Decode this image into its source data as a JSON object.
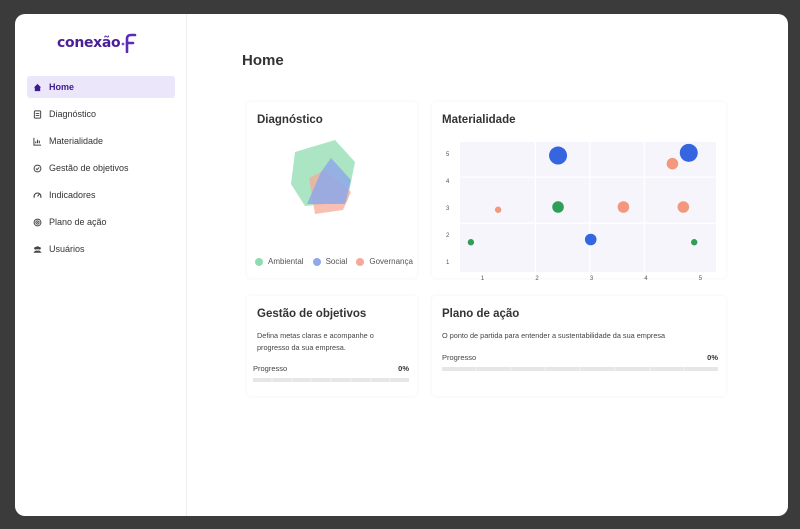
{
  "brand": {
    "name": "conexão",
    "mark": "F",
    "color": "#4b1f98"
  },
  "sidebar": {
    "items": [
      {
        "label": "Home",
        "icon": "home-icon",
        "active": true
      },
      {
        "label": "Diagnóstico",
        "icon": "clipboard-icon",
        "active": false
      },
      {
        "label": "Materialidade",
        "icon": "chart-icon",
        "active": false
      },
      {
        "label": "Gestão de objetivos",
        "icon": "target-icon",
        "active": false
      },
      {
        "label": "Indicadores",
        "icon": "gauge-icon",
        "active": false
      },
      {
        "label": "Plano de ação",
        "icon": "plan-icon",
        "active": false
      },
      {
        "label": "Usuários",
        "icon": "users-icon",
        "active": false
      }
    ]
  },
  "main": {
    "title": "Home",
    "diagnostico": {
      "title": "Diagnóstico",
      "legend": [
        {
          "label": "Ambiental",
          "color": "#8fdcb0"
        },
        {
          "label": "Social",
          "color": "#8fa8ea"
        },
        {
          "label": "Governança",
          "color": "#f5a99a"
        }
      ]
    },
    "materialidade": {
      "title": "Materialidade",
      "y_ticks": [
        "5",
        "4",
        "3",
        "2",
        "1"
      ],
      "x_ticks": [
        "1",
        "2",
        "3",
        "4",
        "5"
      ]
    },
    "gestao": {
      "title": "Gestão de objetivos",
      "description": "Defina metas claras e acompanhe o progresso da sua empresa.",
      "progress_label": "Progresso",
      "progress_value": "0%",
      "progress_fraction": 0
    },
    "plano": {
      "title": "Plano de ação",
      "description": "O ponto de partida para entender a sustentabilidade da sua empresa",
      "progress_label": "Progresso",
      "progress_value": "0%",
      "progress_fraction": 0
    }
  },
  "chart_data": [
    {
      "type": "radar",
      "title": "Diagnóstico",
      "series": [
        {
          "name": "Ambiental",
          "color": "#8fdcb0"
        },
        {
          "name": "Social",
          "color": "#8fa8ea"
        },
        {
          "name": "Governança",
          "color": "#f5a99a"
        }
      ]
    },
    {
      "type": "scatter",
      "title": "Materialidade",
      "xlim": [
        0.8,
        5.5
      ],
      "ylim": [
        0.7,
        5.5
      ],
      "y_ticks": [
        1,
        2,
        3,
        4,
        5
      ],
      "x_ticks": [
        1,
        2,
        3,
        4,
        5
      ],
      "points": [
        {
          "x": 2.6,
          "y": 5.0,
          "size": "large",
          "color": "#3566e0"
        },
        {
          "x": 5.0,
          "y": 5.1,
          "size": "large",
          "color": "#3566e0"
        },
        {
          "x": 4.7,
          "y": 4.7,
          "size": "medium",
          "color": "#f3977f"
        },
        {
          "x": 1.5,
          "y": 3.0,
          "size": "small",
          "color": "#f3977f"
        },
        {
          "x": 2.6,
          "y": 3.1,
          "size": "medium",
          "color": "#2f9e56"
        },
        {
          "x": 3.8,
          "y": 3.1,
          "size": "medium",
          "color": "#f3977f"
        },
        {
          "x": 4.9,
          "y": 3.1,
          "size": "medium",
          "color": "#f3977f"
        },
        {
          "x": 1.0,
          "y": 1.8,
          "size": "small",
          "color": "#2f9e56"
        },
        {
          "x": 3.2,
          "y": 1.9,
          "size": "medium",
          "color": "#3566e0"
        },
        {
          "x": 5.1,
          "y": 1.8,
          "size": "small",
          "color": "#2f9e56"
        }
      ]
    }
  ]
}
